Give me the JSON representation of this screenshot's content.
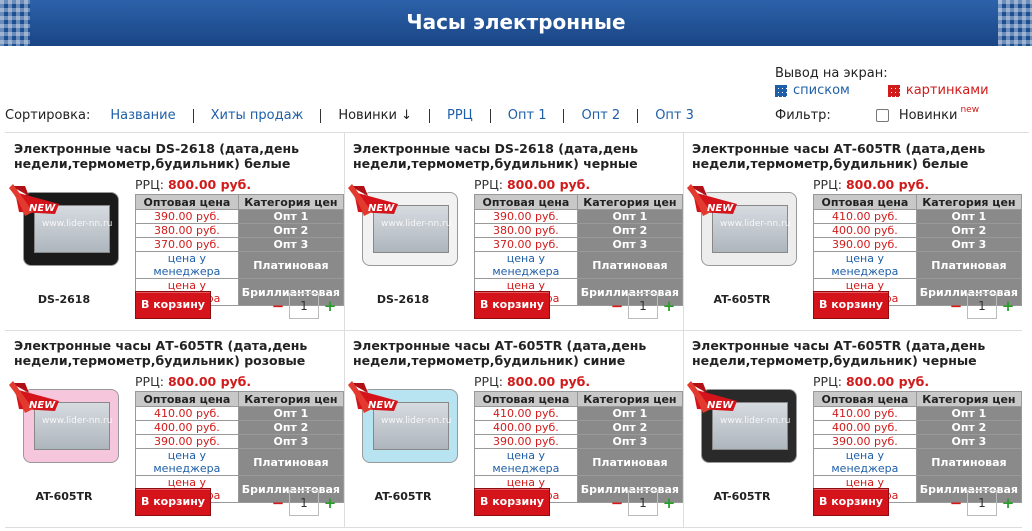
{
  "header": {
    "title": "Часы электронные"
  },
  "sort": {
    "label": "Сортировка:",
    "options": [
      "Название",
      "Хиты продаж",
      "Новинки ↓",
      "РРЦ",
      "Опт 1",
      "Опт 2",
      "Опт 3"
    ]
  },
  "view": {
    "label": "Вывод на экран:",
    "list": "списком",
    "pictures": "картинками"
  },
  "filter": {
    "label": "Фильтр:",
    "new_label": "Новинки",
    "new_sup": "new"
  },
  "table_headers": {
    "price": "Оптовая цена",
    "category": "Категория цен"
  },
  "common": {
    "rrc_label": "РРЦ:",
    "cart_button": "В корзину",
    "qty_minus": "−",
    "qty_plus": "+",
    "manager_price": "цена у менеджера",
    "categories": [
      "Опт 1",
      "Опт 2",
      "Опт 3",
      "Платиновая",
      "Бриллиантовая"
    ],
    "new_badge": "NEW",
    "watermark": "www.lider-nn.ru"
  },
  "products": [
    {
      "name": "Электронные часы DS-2618 (дата,день недели,термометр,будильник) белые",
      "rrc": "800.00 руб.",
      "prices": [
        "390.00 руб.",
        "380.00 руб.",
        "370.00 руб."
      ],
      "model": "DS-2618",
      "qty": "1",
      "body_color": "#1a1a1a"
    },
    {
      "name": "Электронные часы DS-2618 (дата,день недели,термометр,будильник) черные",
      "rrc": "800.00 руб.",
      "prices": [
        "390.00 руб.",
        "380.00 руб.",
        "370.00 руб."
      ],
      "model": "DS-2618",
      "qty": "1",
      "body_color": "#f2f2f2"
    },
    {
      "name": "Электронные часы АТ-605TR (дата,день недели,термометр,будильник) белые",
      "rrc": "800.00 руб.",
      "prices": [
        "410.00 руб.",
        "400.00 руб.",
        "390.00 руб."
      ],
      "model": "AT-605TR",
      "qty": "1",
      "body_color": "#ededed"
    },
    {
      "name": "Электронные часы АТ-605TR (дата,день недели,термометр,будильник) розовые",
      "rrc": "800.00 руб.",
      "prices": [
        "410.00 руб.",
        "400.00 руб.",
        "390.00 руб."
      ],
      "model": "AT-605TR",
      "qty": "1",
      "body_color": "#f6c6dc"
    },
    {
      "name": "Электронные часы АТ-605TR (дата,день недели,термометр,будильник) синие",
      "rrc": "800.00 руб.",
      "prices": [
        "410.00 руб.",
        "400.00 руб.",
        "390.00 руб."
      ],
      "model": "AT-605TR",
      "qty": "1",
      "body_color": "#b8e4f2"
    },
    {
      "name": "Электронные часы АТ-605TR (дата,день недели,термометр,будильник) черные",
      "rrc": "800.00 руб.",
      "prices": [
        "410.00 руб.",
        "400.00 руб.",
        "390.00 руб."
      ],
      "model": "AT-605TR",
      "qty": "1",
      "body_color": "#2a2a2a"
    }
  ],
  "colors": {
    "accent": "#d11b1b",
    "link": "#1f5fa8",
    "banner": "#1d4f93"
  }
}
